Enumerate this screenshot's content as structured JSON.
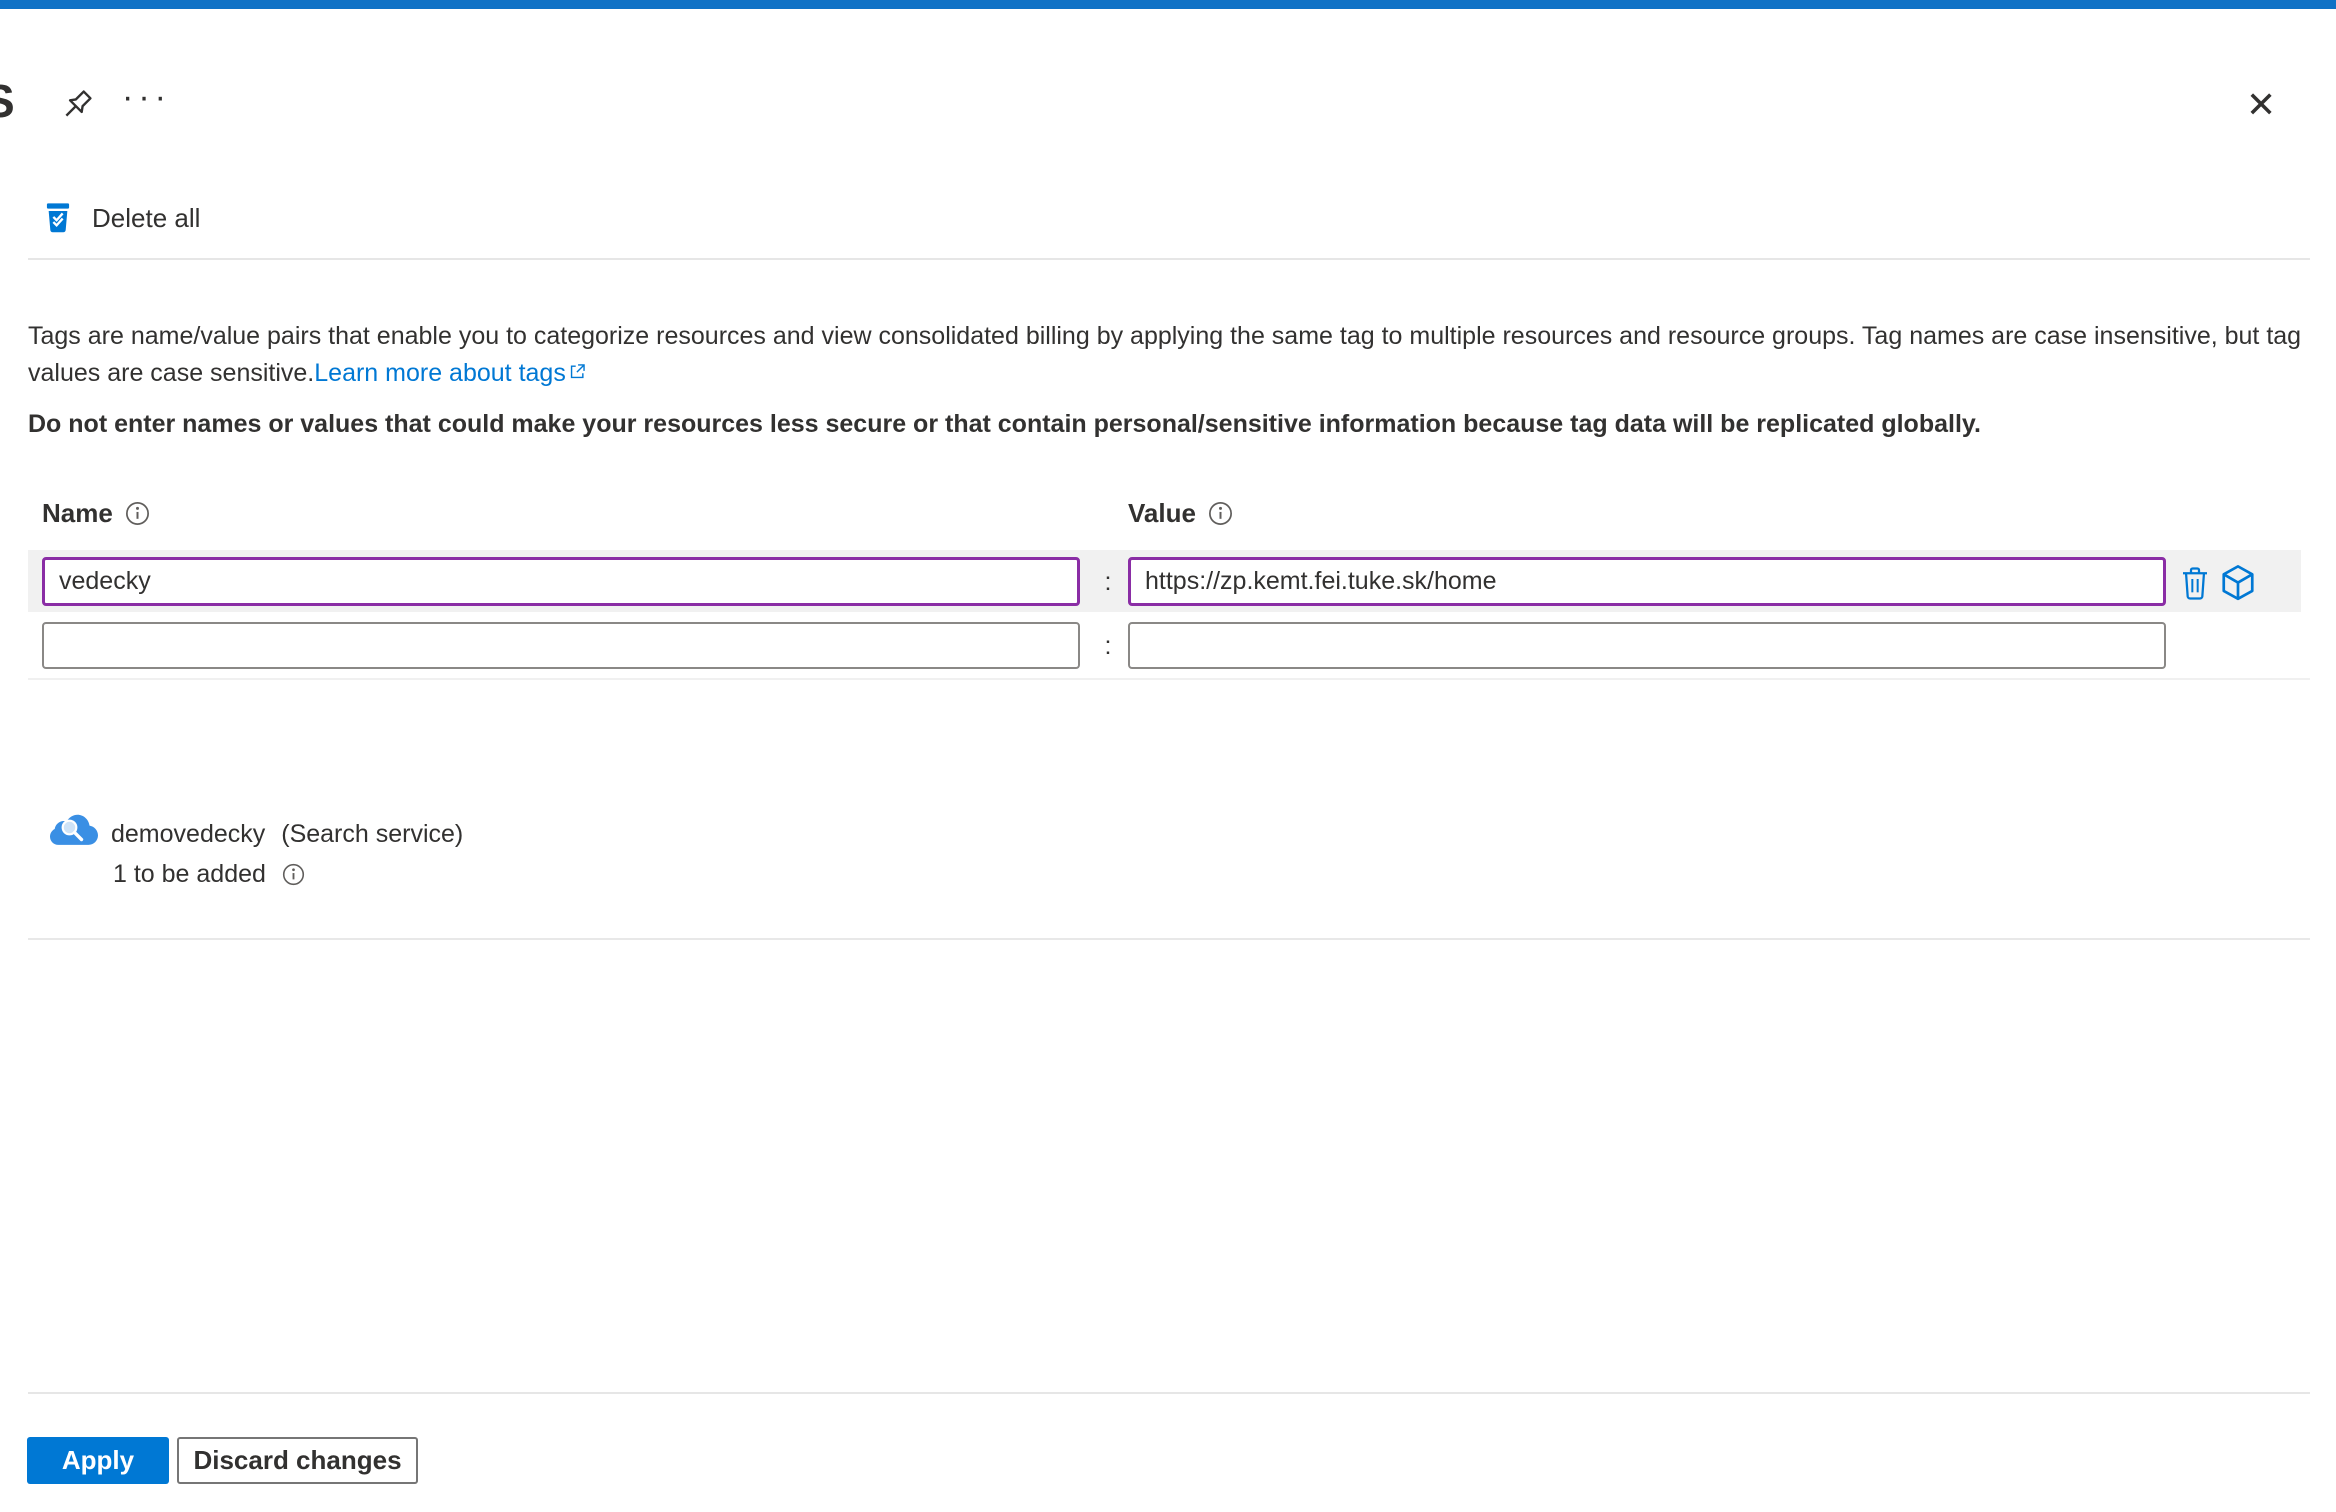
{
  "page": {
    "title_fragment": "S",
    "more_options_glyph": "···",
    "close_glyph": "✕"
  },
  "toolbar": {
    "delete_all_label": "Delete all"
  },
  "description": {
    "text_before_link": "Tags are name/value pairs that enable you to categorize resources and view consolidated billing by applying the same tag to multiple resources and resource groups. Tag names are case insensitive, but tag values are case sensitive.",
    "link_label": "Learn more about tags",
    "warning": "Do not enter names or values that could make your resources less secure or that contain personal/sensitive information because tag data will be replicated globally."
  },
  "tag_editor": {
    "name_header": "Name",
    "value_header": "Value",
    "separator": ":",
    "rows": [
      {
        "name": "vedecky",
        "value": "https://zp.kemt.fei.tuke.sk/home"
      },
      {
        "name": "",
        "value": ""
      }
    ]
  },
  "resource": {
    "name": "demovedecky",
    "type": "(Search service)",
    "status": "1 to be added"
  },
  "footer": {
    "apply_label": "Apply",
    "discard_label": "Discard changes"
  },
  "colors": {
    "accent_blue": "#0078d4",
    "top_bar_blue": "#1072c6",
    "focused_input_purple": "#8a2da5",
    "row_highlight_gray": "#f1f1f1"
  }
}
